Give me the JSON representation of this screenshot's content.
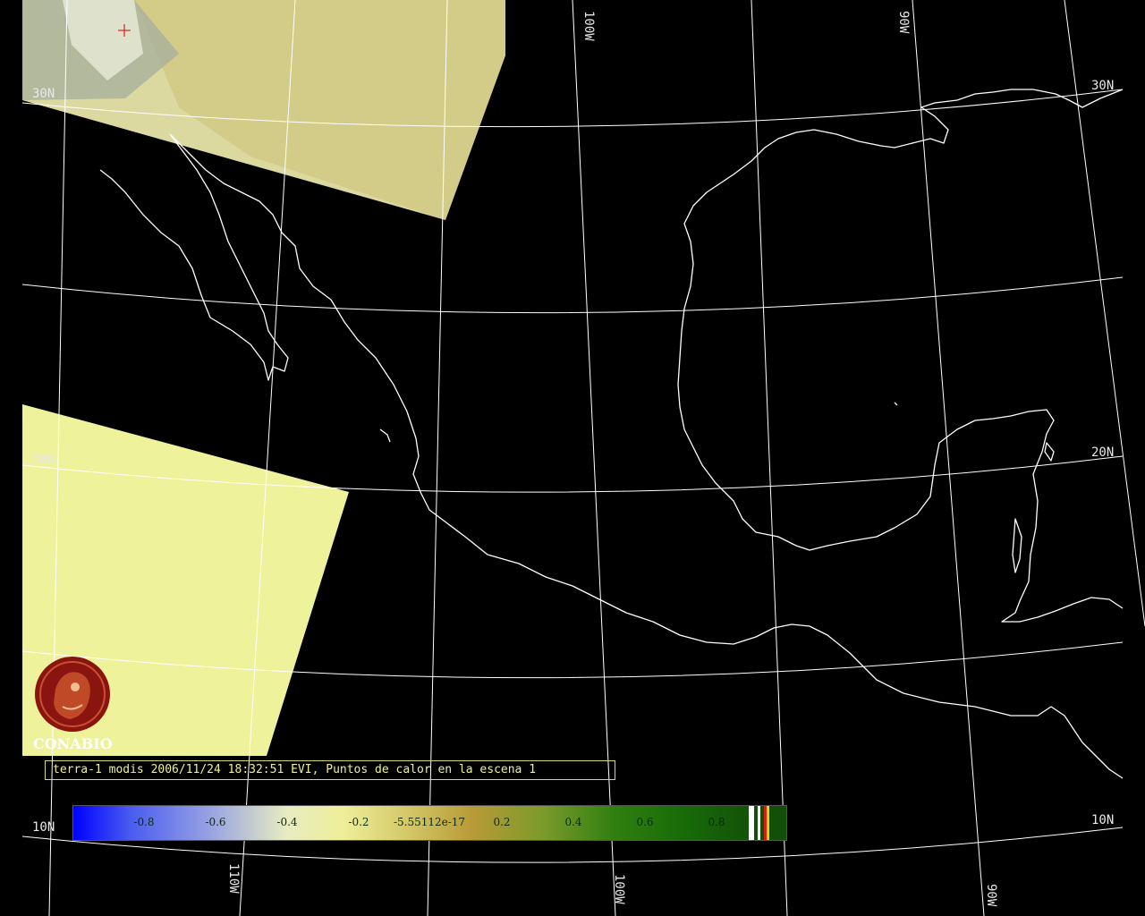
{
  "map": {
    "grid_labels": {
      "lat_left": [
        "30N",
        "20N",
        "10N"
      ],
      "lat_right": [
        "30N",
        "20N",
        "10N"
      ],
      "lon_top": [
        "100W",
        "90W"
      ],
      "lon_bottom": [
        "110W",
        "100W",
        "90W"
      ]
    },
    "colors": {
      "background": "#000000",
      "gridline": "#ffffff",
      "coastline": "#ffffff",
      "satellite_swath": "#eef29a",
      "logo": "#8a1410"
    }
  },
  "caption": "terra-1 modis 2006/11/24 18:32:51 EVI, Puntos de calor en la escena 1",
  "logo": {
    "text": "CONABIO"
  },
  "colorbar": {
    "labels": [
      "-0.8",
      "-0.6",
      "-0.4",
      "-0.2",
      "-5.55112e-17",
      "0.2",
      "0.4",
      "0.6",
      "0.8"
    ]
  }
}
